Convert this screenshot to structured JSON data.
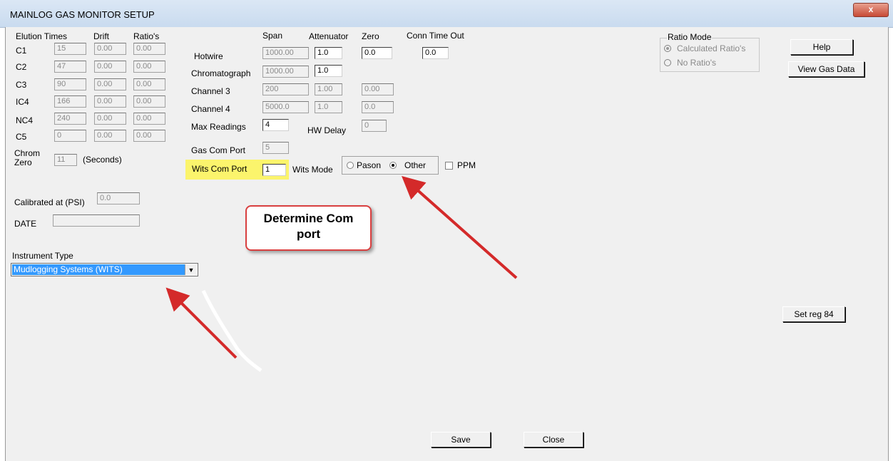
{
  "window": {
    "title": "MAINLOG GAS MONITOR SETUP",
    "close_glyph": "x"
  },
  "elution": {
    "header_times": "Elution Times",
    "header_drift": "Drift",
    "header_ratios": "Ratio's",
    "rows": [
      {
        "label": "C1",
        "time": "15",
        "drift": "0.00",
        "ratio": "0.00"
      },
      {
        "label": "C2",
        "time": "47",
        "drift": "0.00",
        "ratio": "0.00"
      },
      {
        "label": "C3",
        "time": "90",
        "drift": "0.00",
        "ratio": "0.00"
      },
      {
        "label": "IC4",
        "time": "166",
        "drift": "0.00",
        "ratio": "0.00"
      },
      {
        "label": "NC4",
        "time": "240",
        "drift": "0.00",
        "ratio": "0.00"
      },
      {
        "label": "C5",
        "time": "0",
        "drift": "0.00",
        "ratio": "0.00"
      }
    ],
    "chrom_zero_label_1": "Chrom",
    "chrom_zero_label_2": "Zero",
    "chrom_zero_value": "11",
    "chrom_zero_unit": "(Seconds)"
  },
  "channels": {
    "header_span": "Span",
    "header_attenuator": "Attenuator",
    "header_zero": "Zero",
    "header_conn_timeout": "Conn Time Out",
    "hotwire": {
      "label": "Hotwire",
      "span": "1000.00",
      "attenuator": "1.0",
      "zero": "0.0",
      "conn_timeout": "0.0"
    },
    "chromatograph": {
      "label": "Chromatograph",
      "span": "1000.00",
      "attenuator": "1.0"
    },
    "channel3": {
      "label": "Channel 3",
      "span": "200",
      "attenuator": "1.00",
      "zero": "0.00"
    },
    "channel4": {
      "label": "Channel 4",
      "span": "5000.0",
      "attenuator": "1.0",
      "zero": "0.0"
    }
  },
  "max_readings": {
    "label": "Max Readings",
    "value": "4"
  },
  "hw_delay": {
    "label": "HW Delay",
    "value": "0"
  },
  "gas_com_port": {
    "label": "Gas Com Port",
    "value": "5"
  },
  "wits_com_port": {
    "label": "Wits Com Port",
    "value": "1",
    "highlight": "#fbf46c"
  },
  "wits_mode": {
    "label": "Wits Mode",
    "options": [
      "Pason",
      "Other"
    ],
    "selected": "Other"
  },
  "ppm": {
    "label": "PPM",
    "checked": false
  },
  "calibration": {
    "label": "Calibrated at (PSI)",
    "value": "0.0",
    "date_label": "DATE",
    "date_value": ""
  },
  "instrument": {
    "label": "Instrument Type",
    "selected": "Mudlogging Systems (WITS)"
  },
  "ratio_mode": {
    "label": "Ratio Mode",
    "options": [
      "Calculated Ratio's",
      "No Ratio's"
    ],
    "selected": "Calculated Ratio's"
  },
  "buttons": {
    "help": "Help",
    "view_gas_data": "View Gas Data",
    "set_reg": "Set reg 84",
    "save": "Save",
    "close": "Close"
  },
  "annotation": {
    "callout_line1": "Determine Com",
    "callout_line2": "port",
    "color": "#d42a2a"
  }
}
